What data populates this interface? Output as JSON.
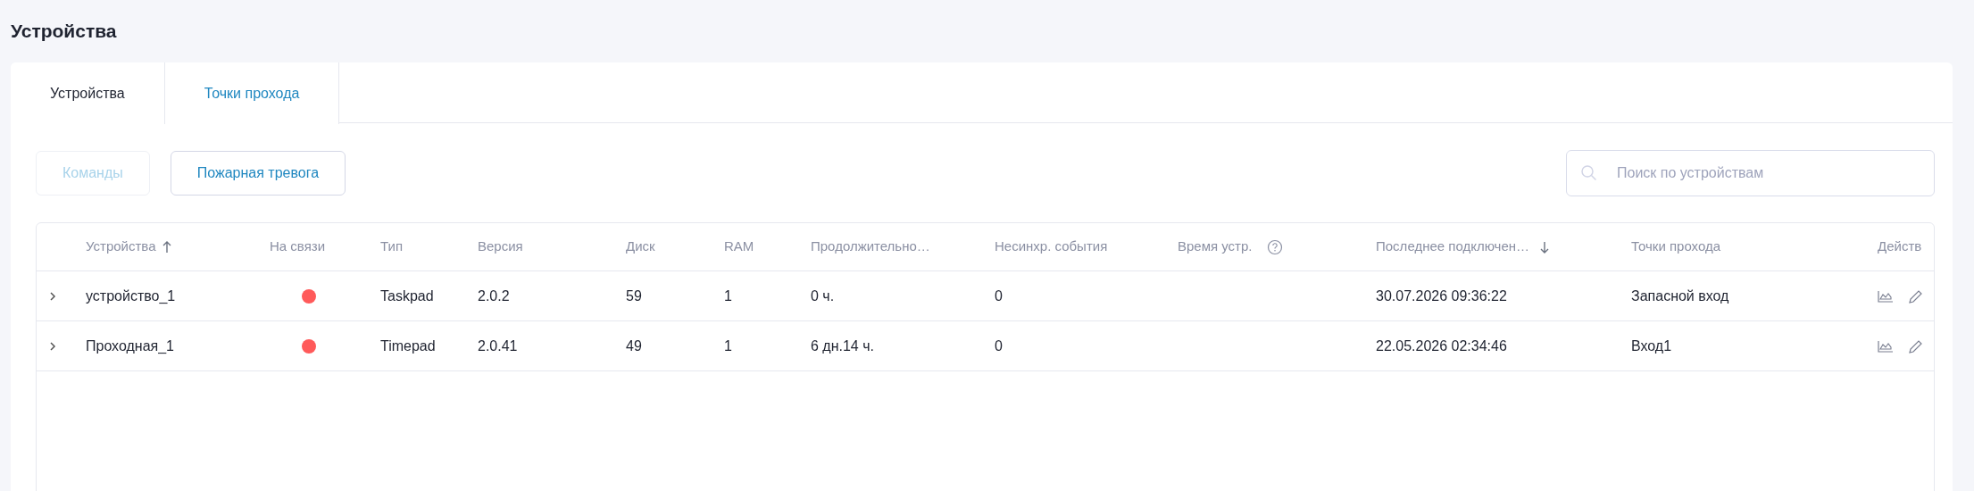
{
  "page_title": "Устройства",
  "tabs": [
    {
      "label": "Устройства",
      "selected": true
    },
    {
      "label": "Точки прохода",
      "selected": false
    }
  ],
  "toolbar": {
    "buttons": [
      {
        "label": "Команды",
        "disabled": true
      },
      {
        "label": "Пожарная тревога",
        "disabled": false
      }
    ],
    "search": {
      "placeholder": "Поиск по устройствам"
    }
  },
  "table": {
    "columns": [
      {
        "label": "Устройства",
        "sort_up": true,
        "sort_down": false,
        "help": false
      },
      {
        "label": "На связи",
        "sort_up": false,
        "sort_down": false,
        "help": false
      },
      {
        "label": "Тип",
        "sort_up": false,
        "sort_down": false,
        "help": false
      },
      {
        "label": "Версия",
        "sort_up": false,
        "sort_down": false,
        "help": false
      },
      {
        "label": "Диск",
        "sort_up": false,
        "sort_down": false,
        "help": false
      },
      {
        "label": "RAM",
        "sort_up": false,
        "sort_down": false,
        "help": false
      },
      {
        "label": "Продолжительно…",
        "sort_up": false,
        "sort_down": false,
        "help": false
      },
      {
        "label": "Несинхр. события",
        "sort_up": false,
        "sort_down": false,
        "help": false
      },
      {
        "label": "Время устр.",
        "sort_up": false,
        "sort_down": false,
        "help": true
      },
      {
        "label": "Последнее подключен…",
        "sort_up": false,
        "sort_down": true,
        "help": false
      },
      {
        "label": "Точки прохода",
        "sort_up": false,
        "sort_down": false,
        "help": false
      },
      {
        "label": "Действ",
        "sort_up": false,
        "sort_down": false,
        "help": false
      }
    ],
    "rows": [
      {
        "name": "устройство_1",
        "online": false,
        "type": "Taskpad",
        "version": "2.0.2",
        "disk": "59",
        "ram": "1",
        "uptime": "0 ч.",
        "unsynced": "0",
        "last_connection": "30.07.2026 09:36:22",
        "access_points": "Запасной вход"
      },
      {
        "name": "Проходная_1",
        "online": false,
        "type": "Timepad",
        "version": "2.0.41",
        "disk": "49",
        "ram": "1",
        "uptime": "6 дн.14 ч.",
        "unsynced": "0",
        "last_connection": "22.05.2026 02:34:46",
        "access_points": "Вход1"
      }
    ]
  }
}
